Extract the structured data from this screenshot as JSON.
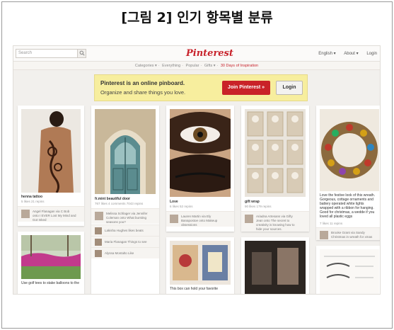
{
  "figure": {
    "title": "[그림 2] 인기 항목별 분류"
  },
  "topbar": {
    "search_placeholder": "Search",
    "logo": "Pinterest",
    "right_links": [
      "English ▾",
      "About ▾",
      "Login"
    ]
  },
  "subnav": {
    "items": [
      "Categories ▾",
      "Everything",
      "Popular",
      "Gifts ▾"
    ],
    "highlight": "30 Days of Inspiration"
  },
  "banner": {
    "line1": "Pinterest is an online pinboard.",
    "line2": "Organize and share things you love.",
    "join_label": "Join Pinterest »",
    "login_label": "Login"
  },
  "pins": [
    {
      "title": "henna tattoo",
      "meta": "5 likes  21 repins",
      "comment": "Angel Flanagan via C Bob onto I EVER Lost My Mind and Got Inked"
    },
    {
      "title": "fr.mint beautiful door",
      "meta": "767 likes  4 comments  7043 repins",
      "comment": "Melissa Schlager via Jennifer Coleman onto What bursting seasons you?",
      "extra_rows": [
        "Lakisha Hughes likes beats",
        "Maria Flanagan Things to see",
        "Alyssa Montalto Like"
      ]
    },
    {
      "title": "Love",
      "meta": "6 likes  52 repins",
      "comment": "Lauren Martin via Ely Banapostoe onto Makeup obsessions"
    },
    {
      "title": "gift wrap",
      "meta": "90 likes  179 repins",
      "comment": "Ariadna Artesans via Gifty Jean onto The secret to creativity is knowing how to hide your sources."
    },
    {
      "title": "Love the festive look of this wreath. Gorgeous, cottage ornaments and battery operated white lights wrapped with a ribbon for hanging. Good for christmas, a wedde if you loved all plastic eggs",
      "meta": "7 likes  11 repins",
      "comment": "Brooke Grant via Sandy Christmas in wreath for xmas"
    }
  ],
  "lower_pins": [
    {
      "caption": "Use golf tees to stake balloons to the"
    },
    {
      "caption": "This box can hold your favorite"
    }
  ],
  "colors": {
    "brand_red": "#c8232c",
    "banner_yellow": "#f7ee9e",
    "background": "#f2f0ed"
  }
}
